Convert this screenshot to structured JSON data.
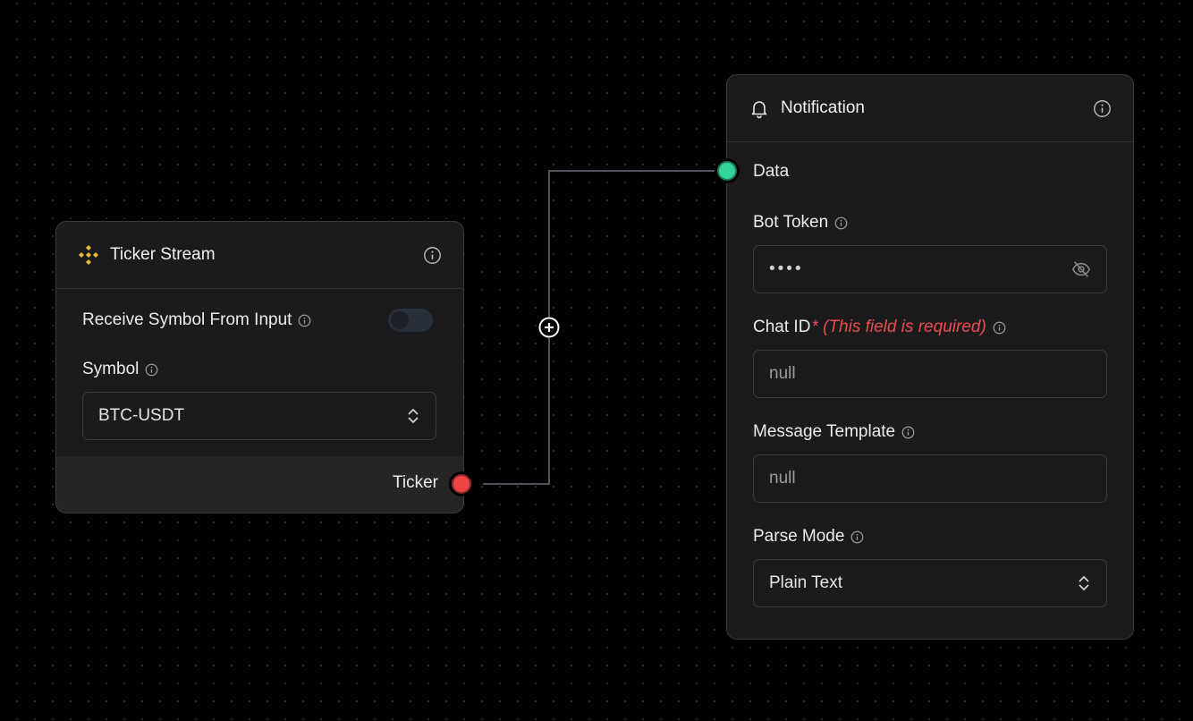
{
  "colors": {
    "background": "#000000",
    "node_bg": "#1b1b1d",
    "output_handle": "#ef4444",
    "input_handle": "#34d399",
    "required": "#ef4b4b",
    "binance_yellow": "#f3ba2f"
  },
  "ticker_node": {
    "title": "Ticker Stream",
    "icon": "binance-icon",
    "receive_symbol_label": "Receive Symbol From Input",
    "receive_symbol_enabled": false,
    "symbol_label": "Symbol",
    "symbol_value": "BTC-USDT",
    "output_label": "Ticker"
  },
  "notification_node": {
    "title": "Notification",
    "icon": "bell-icon",
    "input_label": "Data",
    "bot_token_label": "Bot Token",
    "bot_token_value": "••••",
    "chat_id_label": "Chat ID",
    "chat_id_required": "* (This field is required)",
    "chat_id_value": "null",
    "message_template_label": "Message Template",
    "message_template_value": "null",
    "parse_mode_label": "Parse Mode",
    "parse_mode_value": "Plain Text"
  }
}
